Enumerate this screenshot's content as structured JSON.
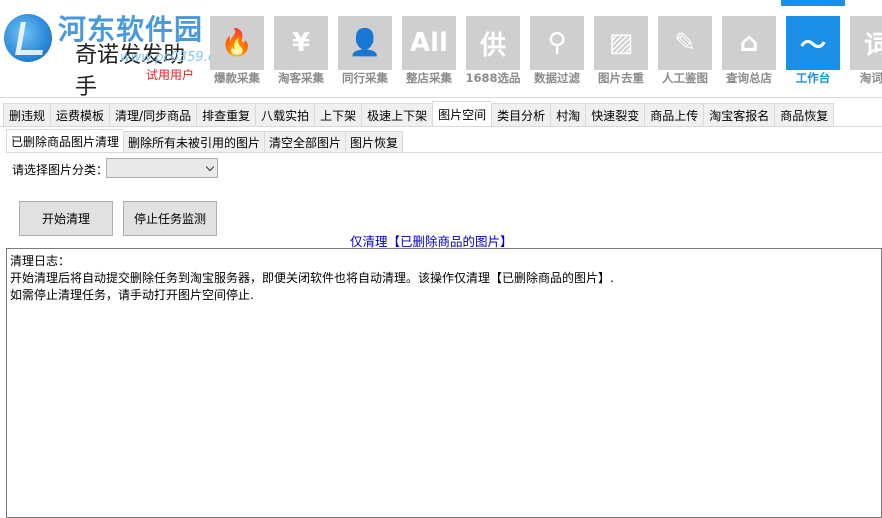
{
  "logo": {
    "site_name": "河东软件园",
    "site_url": "www.pc0359.cn",
    "app_name": "奇诺发发助手",
    "trial_label": "试用用户"
  },
  "toolbar": [
    {
      "label": "爆款采集",
      "icon": "flame-icon",
      "glyph": "🔥"
    },
    {
      "label": "淘客采集",
      "icon": "yen-icon",
      "glyph": "¥"
    },
    {
      "label": "同行采集",
      "icon": "person-icon",
      "glyph": "👤"
    },
    {
      "label": "整店采集",
      "icon": "all-icon",
      "glyph": "All"
    },
    {
      "label": "1688选品",
      "icon": "supply-icon",
      "glyph": "供"
    },
    {
      "label": "数据过滤",
      "icon": "filter-icon",
      "glyph": "⚲"
    },
    {
      "label": "图片去重",
      "icon": "image-icon",
      "glyph": "▨"
    },
    {
      "label": "人工鉴图",
      "icon": "broom-icon",
      "glyph": "✎"
    },
    {
      "label": "查询总店",
      "icon": "store-icon",
      "glyph": "⌂"
    },
    {
      "label": "工作台",
      "icon": "dashboard-icon",
      "glyph": "〜",
      "active": true
    },
    {
      "label": "淘词助",
      "icon": "word-icon",
      "glyph": "词"
    }
  ],
  "tabs_main": [
    {
      "label": "删违规"
    },
    {
      "label": "运费模板"
    },
    {
      "label": "清理/同步商品"
    },
    {
      "label": "排查重复"
    },
    {
      "label": "八载实拍"
    },
    {
      "label": "上下架"
    },
    {
      "label": "极速上下架"
    },
    {
      "label": "图片空间",
      "selected": true
    },
    {
      "label": "类目分析"
    },
    {
      "label": "村淘"
    },
    {
      "label": "快速裂变"
    },
    {
      "label": "商品上传"
    },
    {
      "label": "淘宝客报名"
    },
    {
      "label": "商品恢复"
    }
  ],
  "tabs_sub": [
    {
      "label": "已删除商品图片清理",
      "selected": true
    },
    {
      "label": "删除所有未被引用的图片"
    },
    {
      "label": "清空全部图片"
    },
    {
      "label": "图片恢复"
    }
  ],
  "category": {
    "label": "请选择图片分类：",
    "value": ""
  },
  "buttons": {
    "start": "开始清理",
    "stop": "停止任务监测"
  },
  "notice": "仅清理【已删除商品的图片】",
  "log": {
    "title": "清理日志：",
    "lines": [
      "开始清理后将自动提交删除任务到淘宝服务器，即便关闭软件也将自动清理。该操作仅清理【已删除商品的图片】.",
      "如需停止清理任务，请手动打开图片空间停止."
    ]
  },
  "colors": {
    "accent": "#1b8fe6",
    "trial": "#e32121",
    "notice": "#0000cc",
    "tool_inactive": "#cfcfcf"
  }
}
